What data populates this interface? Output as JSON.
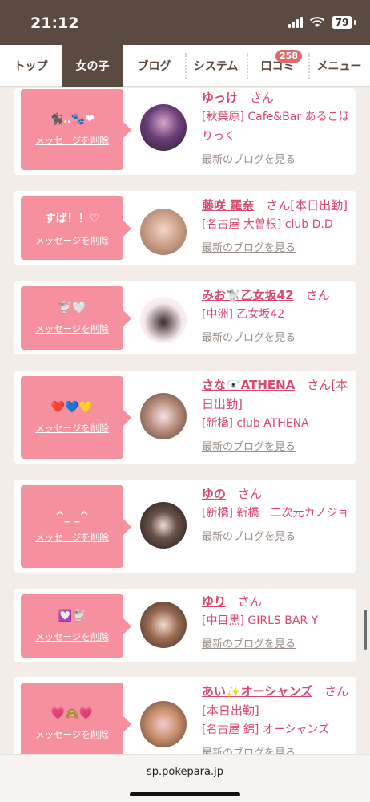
{
  "status": {
    "time": "21:12",
    "battery": "79"
  },
  "nav": {
    "tabs": [
      {
        "label": "トップ"
      },
      {
        "label": "女の子"
      },
      {
        "label": "ブログ"
      },
      {
        "label": "システム"
      },
      {
        "label": "口コミ",
        "badge": "258"
      },
      {
        "label": "メニュー"
      }
    ]
  },
  "delete_label": "メッセージを削除",
  "blog_label": "最新のブログを見る",
  "san_suffix": "さん",
  "entries": [
    {
      "message": "🐈‍⬛‥🐾❤",
      "name": "ゆっけ",
      "extra": "",
      "shop": "[秋葉原] Cafe&Bar あるこほりっく"
    },
    {
      "message": "すば！！♡",
      "name": "藤咲 羅奈",
      "extra": "[本日出勤]",
      "shop": "[名古屋 大曽根] club D.D"
    },
    {
      "message": "🐩🤍",
      "name": "みお🐩乙女坂42",
      "extra": "",
      "shop": "[中洲] 乙女坂42"
    },
    {
      "message": "❤️💙💛",
      "name": "さな🐻‍❄️ATHENA",
      "extra": "[本日出勤]",
      "shop": "[新橋] club ATHENA"
    },
    {
      "message": "^_ _^",
      "name": "ゆの",
      "extra": "",
      "shop": "[新橋] 新橋　二次元カノジョ"
    },
    {
      "message": "💟🐩",
      "name": "ゆり",
      "extra": "",
      "shop": "[中目黒] GIRLS BAR Y"
    },
    {
      "message": "💗🙈💗",
      "name": "あい✨オーシャンズ",
      "extra": "[本日出勤]",
      "shop": "[名古屋 錦] オーシャンズ"
    }
  ],
  "url": "sp.pokepara.jp",
  "colors": {
    "brand_brown": "#5b4a3f",
    "pink_bubble": "#f7909e",
    "link_pink": "#d9486e",
    "badge_red": "#e06a6a"
  },
  "icons": {
    "signal": "cellular-signal-icon",
    "wifi": "wifi-icon",
    "battery": "battery-icon"
  }
}
